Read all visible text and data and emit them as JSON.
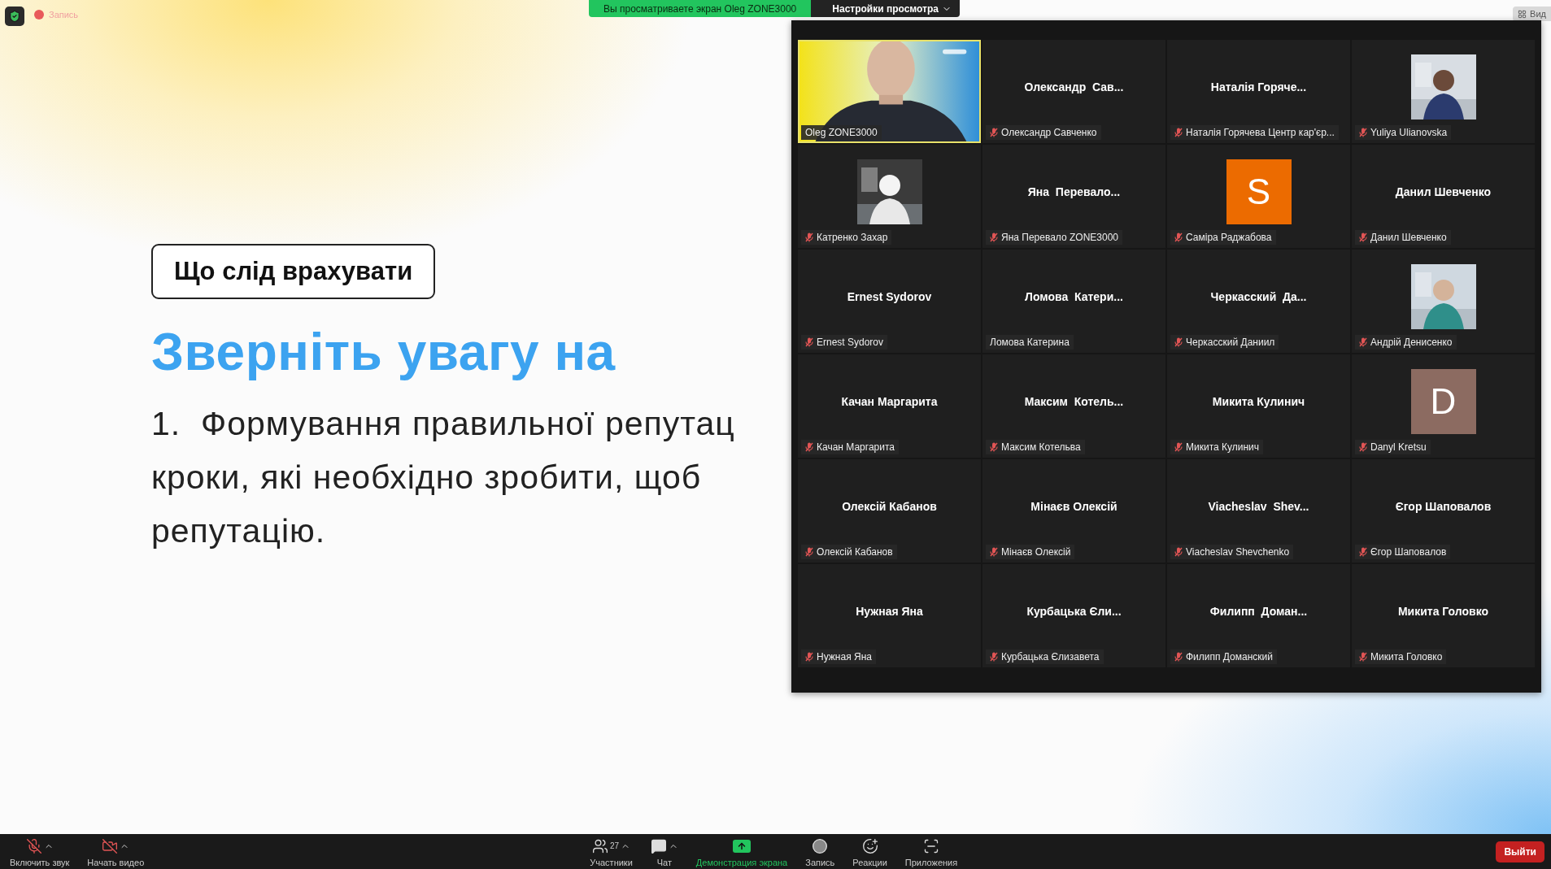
{
  "top_bar": {
    "recording_label": "Запись",
    "sharing_notice": "Вы просматриваете экран Oleg ZONE3000",
    "view_options": "Настройки просмотра",
    "view_button": "Вид"
  },
  "slide": {
    "tag": "Що слід врахувати",
    "heading": "Зверніть увагу на",
    "lines": [
      "1.  Формування правильної репутац",
      "кроки, які необхідно зробити, щоб",
      "репутацію."
    ]
  },
  "gallery": {
    "tiles": [
      {
        "kind": "video",
        "caption": "Oleg ZONE3000",
        "muted": false,
        "speaking": true
      },
      {
        "kind": "name",
        "display_name": "Олександр  Сав...",
        "caption": "Олександр Савченко",
        "muted": true,
        "speaking": false
      },
      {
        "kind": "name",
        "display_name": "Наталія Горяче...",
        "caption": "Наталія Горячева Центр кар'єр...",
        "muted": true,
        "speaking": false
      },
      {
        "caption": "Yuliya Ulianovska",
        "muted": true,
        "speaking": false
      },
      {
        "caption": "Катренко Захар",
        "muted": true,
        "speaking": false
      },
      {
        "kind": "name",
        "display_name": "Яна  Перевало...",
        "caption": "Яна Перевало ZONE3000",
        "muted": true,
        "speaking": false
      },
      {
        "kind": "initial",
        "initial": "S",
        "color": "#ec6b00",
        "caption": "Саміра Раджабова",
        "muted": true,
        "speaking": false
      },
      {
        "kind": "name",
        "display_name": "Данил Шевченко",
        "caption": "Данил Шевченко",
        "muted": true,
        "speaking": false
      },
      {
        "kind": "name",
        "display_name": "Ernest Sydorov",
        "caption": "Ernest Sydorov",
        "muted": true,
        "speaking": false
      },
      {
        "kind": "name",
        "display_name": "Ломова  Катери...",
        "caption": "Ломова Катерина",
        "muted": false,
        "speaking": false
      },
      {
        "kind": "name",
        "display_name": "Черкасский  Да...",
        "caption": "Черкасский Даниил",
        "muted": true,
        "speaking": false
      },
      {
        "caption": "Андрій Денисенко",
        "muted": true,
        "speaking": false
      },
      {
        "kind": "name",
        "display_name": "Качан Маргарита",
        "caption": "Качан Маргарита",
        "muted": true,
        "speaking": false
      },
      {
        "kind": "name",
        "display_name": "Максим  Котель...",
        "caption": "Максим Котельва",
        "muted": true,
        "speaking": false
      },
      {
        "kind": "name",
        "display_name": "Микита Кулинич",
        "caption": "Микита Кулинич",
        "muted": true,
        "speaking": false
      },
      {
        "kind": "initial",
        "initial": "D",
        "color": "#8c6b61",
        "caption": "Danyl Kretsu",
        "muted": true,
        "speaking": false
      },
      {
        "kind": "name",
        "display_name": "Олексій Кабанов",
        "caption": "Олексій Кабанов",
        "muted": true,
        "speaking": false
      },
      {
        "kind": "name",
        "display_name": "Мінаєв Олексій",
        "caption": "Мінаєв Олексій",
        "muted": true,
        "speaking": false
      },
      {
        "kind": "name",
        "display_name": "Viacheslav  Shev...",
        "caption": "Viacheslav Shevchenko",
        "muted": true,
        "speaking": false
      },
      {
        "kind": "name",
        "display_name": "Єгор Шаповалов",
        "caption": "Єгор Шаповалов",
        "muted": true,
        "speaking": false
      },
      {
        "kind": "name",
        "display_name": "Нужная Яна",
        "caption": "Нужная Яна",
        "muted": true,
        "speaking": false
      },
      {
        "kind": "name",
        "display_name": "Курбацька Єли...",
        "caption": "Курбацька Єлизавета",
        "muted": true,
        "speaking": false
      },
      {
        "kind": "name",
        "display_name": "Филипп  Доман...",
        "caption": "Филипп Доманский",
        "muted": true,
        "speaking": false
      },
      {
        "kind": "name",
        "display_name": "Микита Головко",
        "caption": "Микита Головко",
        "muted": true,
        "speaking": false
      }
    ]
  },
  "toolbar": {
    "left": [
      {
        "kind": "audio",
        "label": "Включить звук",
        "menu": true
      },
      {
        "kind": "video",
        "label": "Начать видео",
        "menu": true
      }
    ],
    "center": [
      {
        "kind": "participants",
        "label": "Участники",
        "count": "27",
        "menu": true
      },
      {
        "kind": "chat",
        "label": "Чат",
        "menu": true
      },
      {
        "kind": "share",
        "label": "Демонстрация экрана",
        "menu": false
      },
      {
        "kind": "record",
        "label": "Запись",
        "menu": false
      },
      {
        "kind": "reactions",
        "label": "Реакции",
        "menu": false
      },
      {
        "kind": "apps",
        "label": "Приложения",
        "menu": false
      }
    ],
    "leave": "Выйти"
  }
}
